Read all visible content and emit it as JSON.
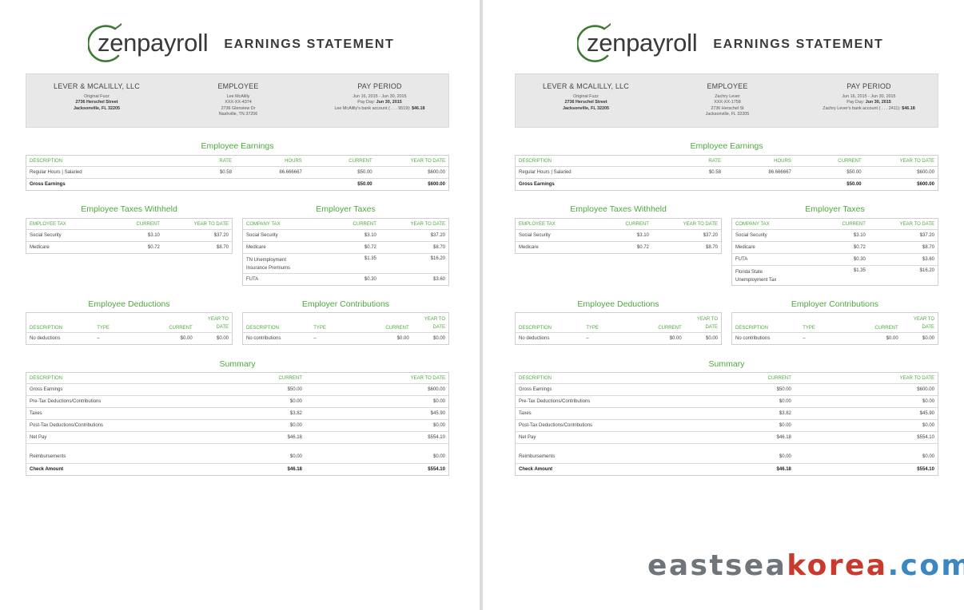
{
  "pages": [
    {
      "brand": "zenpayroll",
      "statement_title": "EARNINGS STATEMENT",
      "company": {
        "heading": "LEVER & MCALILLY, LLC",
        "line1": "Original Fuzz",
        "line2": "2736 Herschel Street",
        "line3": "Jacksonville, FL 32205"
      },
      "employee": {
        "heading": "EMPLOYEE",
        "line1": "Lee McAlilly",
        "line2": "XXX-XX-4374",
        "line3": "2736 Glenview Dr",
        "line4": "Nashville, TN 37206"
      },
      "pay_period": {
        "heading": "PAY PERIOD",
        "line1": "Jun 16, 2015 - Jun 30, 2015",
        "pay_day_label": "Pay Day:",
        "pay_day": "Jun 30, 2015",
        "bank_label": "Lee McAlilly's bank account ( . . . 9519):",
        "bank_amount": "$46.18"
      },
      "earnings": {
        "title": "Employee Earnings",
        "headers": [
          "DESCRIPTION",
          "RATE",
          "HOURS",
          "CURRENT",
          "YEAR TO DATE"
        ],
        "rows": [
          [
            "Regular Hours | Salaried",
            "$0.58",
            "86.666667",
            "$50.00",
            "$600.00"
          ]
        ],
        "total": [
          "Gross Earnings",
          "",
          "",
          "$50.00",
          "$600.00"
        ]
      },
      "employee_taxes": {
        "title": "Employee Taxes Withheld",
        "headers": [
          "EMPLOYEE TAX",
          "CURRENT",
          "YEAR TO DATE"
        ],
        "rows": [
          [
            "Social Security",
            "$3.10",
            "$37.20"
          ],
          [
            "Medicare",
            "$0.72",
            "$8.70"
          ]
        ]
      },
      "employer_taxes": {
        "title": "Employer Taxes",
        "headers": [
          "COMPANY TAX",
          "CURRENT",
          "YEAR TO DATE"
        ],
        "rows": [
          {
            "name1": "Social Security",
            "name2": "",
            "current": "$3.10",
            "ytd": "$37.20"
          },
          {
            "name1": "Medicare",
            "name2": "",
            "current": "$0.72",
            "ytd": "$8.70"
          },
          {
            "name1": "TN Unemployment",
            "name2": "Insurance Premiums",
            "current": "$1.35",
            "ytd": "$16.20"
          },
          {
            "name1": "FUTA",
            "name2": "",
            "current": "$0.30",
            "ytd": "$3.60"
          }
        ]
      },
      "employee_deductions": {
        "title": "Employee Deductions",
        "headers": [
          "DESCRIPTION",
          "TYPE",
          "CURRENT",
          "YEAR TO",
          "DATE"
        ],
        "row": [
          "No deductions",
          "–",
          "$0.00",
          "$0.00"
        ]
      },
      "employer_contributions": {
        "title": "Employer Contributions",
        "headers": [
          "DESCRIPTION",
          "TYPE",
          "CURRENT",
          "YEAR TO",
          "DATE"
        ],
        "row": [
          "No contributions",
          "–",
          "$0.00",
          "$0.00"
        ]
      },
      "summary": {
        "title": "Summary",
        "headers": [
          "DESCRIPTION",
          "CURRENT",
          "YEAR TO DATE"
        ],
        "rows": [
          [
            "Gross Earnings",
            "$50.00",
            "$600.00"
          ],
          [
            "Pre-Tax Deductions/Contributions",
            "$0.00",
            "$0.00"
          ],
          [
            "Taxes",
            "$3.82",
            "$45.90"
          ],
          [
            "Post-Tax Deductions/Contributions",
            "$0.00",
            "$0.00"
          ],
          [
            "Net Pay",
            "$46.18",
            "$554.10"
          ],
          [
            "Reimbursements",
            "$0.00",
            "$0.00"
          ],
          [
            "Check Amount",
            "$46.18",
            "$554.10"
          ]
        ]
      }
    },
    {
      "brand": "zenpayroll",
      "statement_title": "EARNINGS STATEMENT",
      "company": {
        "heading": "LEVER & MCALILLY, LLC",
        "line1": "Original Fuzz",
        "line2": "2736 Herschel Street",
        "line3": "Jacksonville, FL 32205"
      },
      "employee": {
        "heading": "EMPLOYEE",
        "line1": "Zachry Lever",
        "line2": "XXX-XX-1758",
        "line3": "2736 Herschel St",
        "line4": "Jacksonville, FL 32205"
      },
      "pay_period": {
        "heading": "PAY PERIOD",
        "line1": "Jun 16, 2015 - Jun 30, 2015",
        "pay_day_label": "Pay Day:",
        "pay_day": "Jun 30, 2015",
        "bank_label": "Zachry Lever's bank account ( . . . 2411):",
        "bank_amount": "$46.18"
      },
      "earnings": {
        "title": "Employee Earnings",
        "headers": [
          "DESCRIPTION",
          "RATE",
          "HOURS",
          "CURRENT",
          "YEAR TO DATE"
        ],
        "rows": [
          [
            "Regular Hours | Salaried",
            "$0.58",
            "86.666667",
            "$50.00",
            "$600.00"
          ]
        ],
        "total": [
          "Gross Earnings",
          "",
          "",
          "$50.00",
          "$600.00"
        ]
      },
      "employee_taxes": {
        "title": "Employee Taxes Withheld",
        "headers": [
          "EMPLOYEE TAX",
          "CURRENT",
          "YEAR TO DATE"
        ],
        "rows": [
          [
            "Social Security",
            "$3.10",
            "$37.20"
          ],
          [
            "Medicare",
            "$0.72",
            "$8.70"
          ]
        ]
      },
      "employer_taxes": {
        "title": "Employer Taxes",
        "headers": [
          "COMPANY TAX",
          "CURRENT",
          "YEAR TO DATE"
        ],
        "rows": [
          {
            "name1": "Social Security",
            "name2": "",
            "current": "$3.10",
            "ytd": "$37.20"
          },
          {
            "name1": "Medicare",
            "name2": "",
            "current": "$0.72",
            "ytd": "$8.70"
          },
          {
            "name1": "FUTA",
            "name2": "",
            "current": "$0.30",
            "ytd": "$3.60"
          },
          {
            "name1": "Florida State",
            "name2": "Unemployment Tax",
            "current": "$1.35",
            "ytd": "$16.20"
          }
        ]
      },
      "employee_deductions": {
        "title": "Employee Deductions",
        "headers": [
          "DESCRIPTION",
          "TYPE",
          "CURRENT",
          "YEAR TO",
          "DATE"
        ],
        "row": [
          "No deductions",
          "–",
          "$0.00",
          "$0.00"
        ]
      },
      "employer_contributions": {
        "title": "Employer Contributions",
        "headers": [
          "DESCRIPTION",
          "TYPE",
          "CURRENT",
          "YEAR TO",
          "DATE"
        ],
        "row": [
          "No contributions",
          "–",
          "$0.00",
          "$0.00"
        ]
      },
      "summary": {
        "title": "Summary",
        "headers": [
          "DESCRIPTION",
          "CURRENT",
          "YEAR TO DATE"
        ],
        "rows": [
          [
            "Gross Earnings",
            "$50.00",
            "$600.00"
          ],
          [
            "Pre-Tax Deductions/Contributions",
            "$0.00",
            "$0.00"
          ],
          [
            "Taxes",
            "$3.82",
            "$45.90"
          ],
          [
            "Post-Tax Deductions/Contributions",
            "$0.00",
            "$0.00"
          ],
          [
            "Net Pay",
            "$46.18",
            "$554.10"
          ],
          [
            "Reimbursements",
            "$0.00",
            "$0.00"
          ],
          [
            "Check Amount",
            "$46.18",
            "$554.10"
          ]
        ]
      }
    }
  ],
  "watermark": {
    "part1": "eastsea",
    "part2": "korea",
    "part3": ".com"
  },
  "colors": {
    "accent_green": "#4ea83f",
    "header_gray": "#e8e8e8",
    "watermark_gray": "#6f7578",
    "watermark_red": "#c9392d",
    "watermark_blue": "#3a87c2"
  }
}
